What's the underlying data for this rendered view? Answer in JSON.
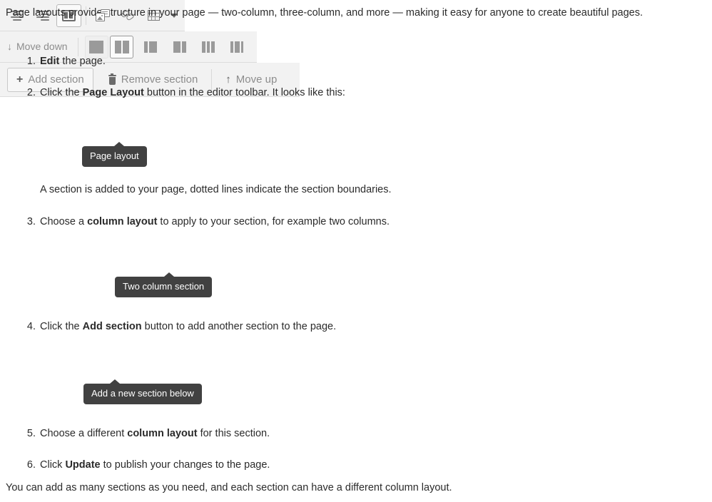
{
  "intro": "Page layouts provide structure in your page — two-column, three-column, and more — making it easy for anyone to create beautiful pages.",
  "outro": "You can add as many sections as you need, and each section can have a different column layout.",
  "steps": [
    {
      "num": "1.",
      "prefix": "",
      "bold": "Edit",
      "suffix": " the page."
    },
    {
      "num": "2.",
      "prefix": "Click the ",
      "bold": "Page Layout",
      "suffix": " button in the editor toolbar. It looks like this:"
    },
    {
      "num": "3.",
      "prefix": "Choose a ",
      "bold": "column layout",
      "suffix": " to apply to your section, for example two columns."
    },
    {
      "num": "4.",
      "prefix": "Click the ",
      "bold": "Add section",
      "suffix": " button to add another section to the page."
    },
    {
      "num": "5.",
      "prefix": "Choose a different ",
      "bold": "column layout",
      "suffix": " for this section."
    },
    {
      "num": "6.",
      "prefix": "Click ",
      "bold": "Update",
      "suffix": " to publish your changes to the page."
    }
  ],
  "note": "A section is added to your page, dotted lines indicate the section boundaries.",
  "editor_toolbar": {
    "buttons": [
      {
        "name": "align-center-icon",
        "label": "Align center"
      },
      {
        "name": "align-right-icon",
        "label": "Align right"
      },
      {
        "name": "page-layout-icon",
        "label": "Page layout"
      },
      {
        "name": "insert-media-icon",
        "label": "Insert media"
      },
      {
        "name": "link-icon",
        "label": "Link"
      },
      {
        "name": "table-icon",
        "label": "Table"
      },
      {
        "name": "chevron-down-icon",
        "label": "More"
      }
    ],
    "tooltip": "Page layout"
  },
  "column_layout_toolbar": {
    "move_down_label": "Move down",
    "move_down_icon": "↓",
    "options": [
      {
        "name": "one-column-section",
        "weights": [
          1
        ]
      },
      {
        "name": "two-column-section",
        "weights": [
          1,
          1
        ]
      },
      {
        "name": "narrow-wide-section",
        "weights": [
          1,
          2
        ]
      },
      {
        "name": "wide-narrow-section",
        "weights": [
          2,
          1
        ]
      },
      {
        "name": "three-column-section",
        "weights": [
          1,
          1,
          1
        ]
      },
      {
        "name": "narrow-wide-narrow-section",
        "weights": [
          1,
          2,
          1
        ]
      }
    ],
    "selected_index": 1,
    "tooltip": "Two column section"
  },
  "section_toolbar": {
    "add_label": "Add section",
    "add_icon": "+",
    "remove_label": "Remove section",
    "remove_icon": "trash-icon",
    "move_up_label": "Move up",
    "move_up_icon": "↑",
    "tooltip": "Add a new section below"
  },
  "colors": {
    "toolbar_bg": "#f2f2f2",
    "toolbar_border": "#dcdcdc",
    "tooltip_bg": "#414141",
    "tooltip_text": "#ffffff",
    "icon_gray": "#7d7d7d",
    "muted_text": "#8d8d8d",
    "body_text": "#2b2b2b"
  }
}
